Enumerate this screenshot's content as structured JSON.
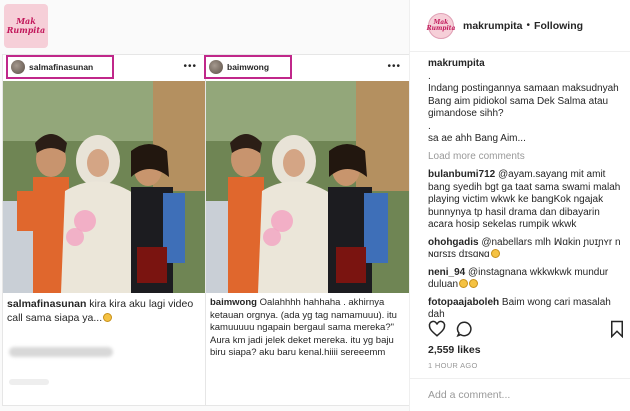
{
  "logo": {
    "line1": "Mak",
    "line2": "Rumpita"
  },
  "left_panel": {
    "username": "salmafinasunan",
    "caption_user": "salmafinasunan",
    "caption_text": "kira kira aku lagi video call sama siapa ya..."
  },
  "right_panel": {
    "username": "baimwong",
    "caption_user": "baimwong",
    "caption_text": "Oalahhhh hahhaha . akhirnya ketauan orgnya. (ada yg tag namamuuu). itu kamuuuuu ngapain bergaul sama mereka?\" Aura km jadi jelek deket mereka. itu yg baju biru siapa? aku baru kenal.hiiii sereeemm"
  },
  "header": {
    "username": "makrumpita",
    "separator": "•",
    "follow_label": "Following",
    "avatar_text": "Mak Rumpita"
  },
  "caption": {
    "username": "makrumpita",
    "line1": ".",
    "line2": "Indang postingannya samaan maksudnyah Bang aim pidiokol sama Dek Salma atau gimandose sihh?",
    "line3": ".",
    "line4": "sa ae ahh Bang Aim..."
  },
  "load_more_label": "Load more comments",
  "comments": [
    {
      "user": "bulanbumi712",
      "mention": "@ayam.sayang",
      "text": " mit amit bang syedih bgt ga taat sama swami malah playing victim wkwk ke bangKok ngajak bunnynya tp hasil drama dan dibayarin acara hosip sekelas rumpik wkwk"
    },
    {
      "user": "ohohgadis",
      "mention": "@nabellars",
      "text": " mlh ꟽɑkin ɲʋɪɲʏr n ɴɑrsɪs dɪsɑɴɑ"
    },
    {
      "user": "neni_94",
      "mention": "@instagnana",
      "text": " wkkwkwk mundur duluan"
    },
    {
      "user": "fotopaajaboleh",
      "mention": "",
      "text": " Baim wong cari masalah dah"
    }
  ],
  "likes": "2,559 likes",
  "time_ago": "1 HOUR AGO",
  "add_comment_placeholder": "Add a comment...",
  "icons": [
    "heart-icon",
    "comment-icon",
    "bookmark-icon",
    "more-dots-icon"
  ],
  "colors": {
    "highlight_border": "#c0278a",
    "logo_bg": "#f6cfd8",
    "muted": "#999999"
  }
}
